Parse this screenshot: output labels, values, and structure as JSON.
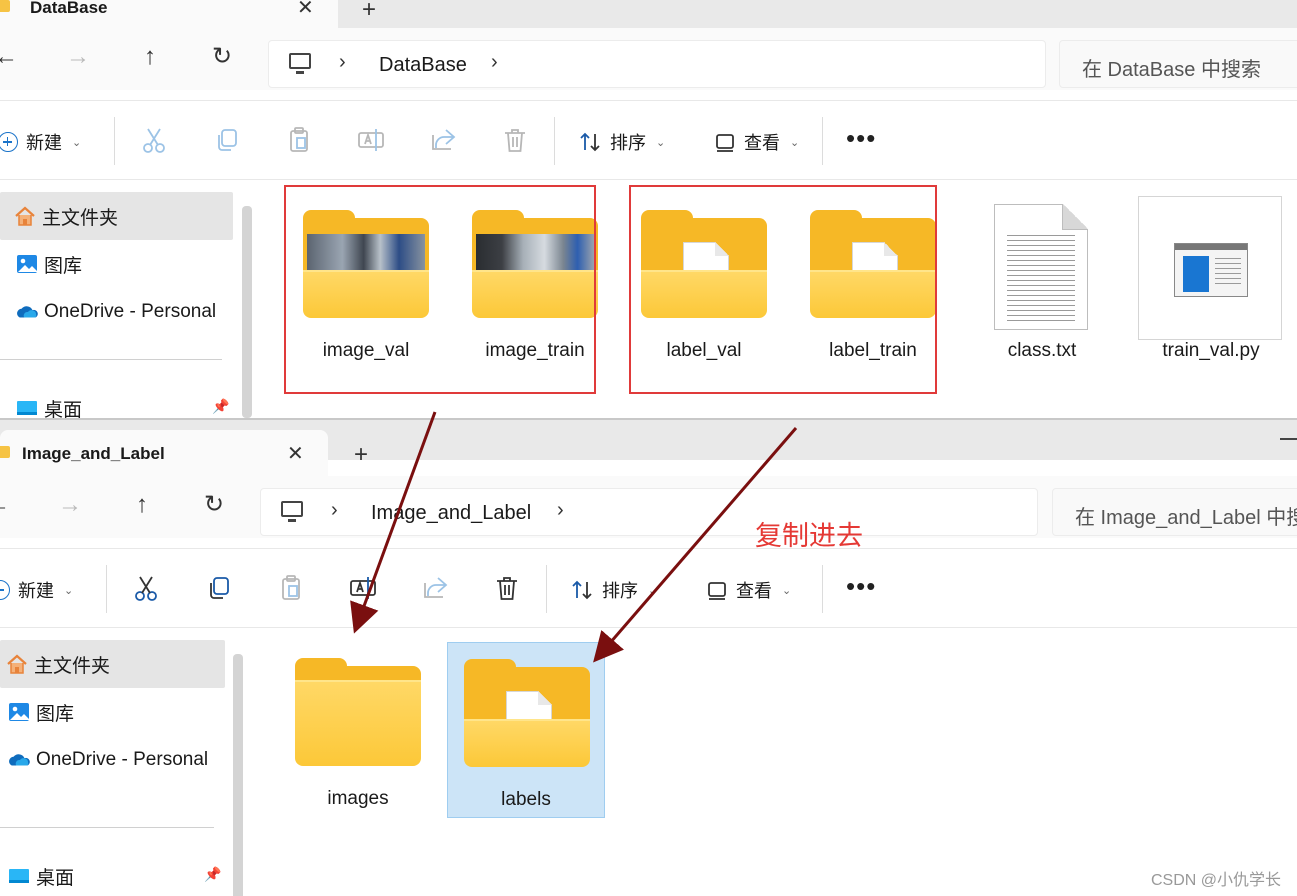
{
  "window_top": {
    "tab_title": "DataBase",
    "address": {
      "segment": "DataBase"
    },
    "search_placeholder": "在 DataBase 中搜索",
    "toolbar": {
      "new_label": "新建",
      "sort_label": "排序",
      "view_label": "查看",
      "more_label": "•••"
    },
    "sidebar": [
      {
        "label": "主文件夹",
        "icon": "home-icon"
      },
      {
        "label": "图库",
        "icon": "gallery-icon"
      },
      {
        "label": "OneDrive - Personal",
        "icon": "onedrive-icon"
      },
      {
        "label": "桌面",
        "icon": "desktop-icon"
      }
    ],
    "items": [
      {
        "name": "image_val",
        "icon": "folder-photo-icon"
      },
      {
        "name": "image_train",
        "icon": "folder-photo-icon"
      },
      {
        "name": "label_val",
        "icon": "folder-doc-icon"
      },
      {
        "name": "label_train",
        "icon": "folder-doc-icon"
      },
      {
        "name": "class.txt",
        "icon": "text-file-icon"
      },
      {
        "name": "train_val.py",
        "icon": "python-file-icon"
      }
    ]
  },
  "window_bottom": {
    "tab_title": "Image_and_Label",
    "address": {
      "segment": "Image_and_Label"
    },
    "search_placeholder": "在 Image_and_Label 中搜",
    "toolbar": {
      "new_label": "新建",
      "sort_label": "排序",
      "view_label": "查看",
      "more_label": "•••"
    },
    "sidebar": [
      {
        "label": "主文件夹",
        "icon": "home-icon"
      },
      {
        "label": "图库",
        "icon": "gallery-icon"
      },
      {
        "label": "OneDrive - Personal",
        "icon": "onedrive-icon"
      },
      {
        "label": "桌面",
        "icon": "desktop-icon"
      }
    ],
    "items": [
      {
        "name": "images",
        "icon": "folder-icon"
      },
      {
        "name": "labels",
        "icon": "folder-doc-icon",
        "selected": true
      }
    ]
  },
  "annotation": {
    "text": "复制进去",
    "color": "#e53935"
  },
  "watermark": "CSDN @小仇学长",
  "colors": {
    "highlight_box": "#e03a3a",
    "arrow": "#7a0f0f",
    "selection": "#cce4f7",
    "folder": "#f6b826"
  }
}
